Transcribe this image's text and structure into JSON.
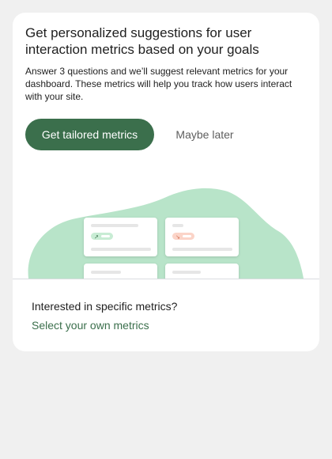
{
  "card": {
    "title": "Get personalized suggestions for user interaction metrics based on your goals",
    "description": "Answer 3 questions and we’ll suggest relevant metrics for your dashboard. These metrics will help you track how users interact with your site.",
    "primary_button_label": "Get tailored metrics",
    "secondary_button_label": "Maybe later"
  },
  "footer": {
    "title": "Interested in specific metrics?",
    "link_label": "Select your own metrics"
  },
  "colors": {
    "page_background": "#f0f0f0",
    "primary_green": "#3b6f4c",
    "blob_green": "#b8e4c9",
    "chip_green": "#c8ecd4",
    "chip_red": "#fbd4c8"
  },
  "illustration": {
    "icons": [
      "trend-up-icon",
      "trend-down-icon",
      "trend-down-icon",
      "trend-up-icon"
    ]
  }
}
